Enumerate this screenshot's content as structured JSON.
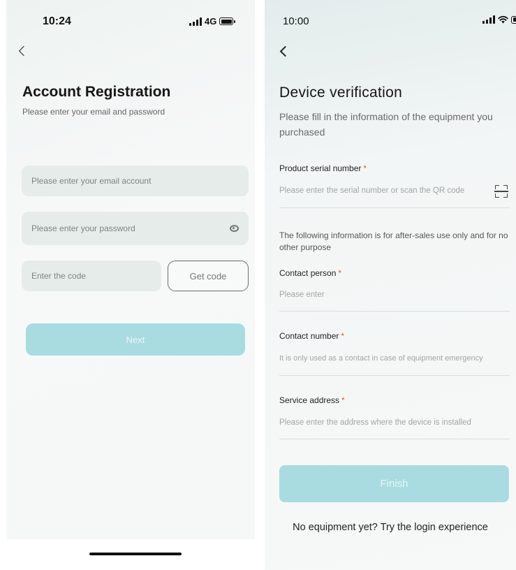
{
  "left": {
    "status": {
      "time": "10:24",
      "network": "4G"
    },
    "title": "Account Registration",
    "subtitle": "Please enter your email and password",
    "email_placeholder": "Please enter your email account",
    "password_placeholder": "Please enter your password",
    "code_placeholder": "Enter the code",
    "get_code_label": "Get code",
    "next_label": "Next"
  },
  "right": {
    "status": {
      "time": "10:00"
    },
    "title": "Device verification",
    "subtitle": "Please fill in the information of the equipment you purchased",
    "serial": {
      "label": "Product serial number",
      "placeholder": "Please enter the serial number or scan the QR code"
    },
    "note": "The following information is for after-sales use only and for no other purpose",
    "contact_person": {
      "label": "Contact person",
      "placeholder": "Please enter"
    },
    "contact_number": {
      "label": "Contact number",
      "placeholder": "It is only used as a contact in case of equipment emergency"
    },
    "service_address": {
      "label": "Service address",
      "placeholder": "Please enter the address where the device is installed"
    },
    "required_mark": "*",
    "finish_label": "Finish",
    "login_link": "No equipment yet? Try the login experience"
  },
  "colors": {
    "accent_button": "#a9dce1",
    "required_star": "#e05a3a",
    "field_bg": "#e6ecea"
  },
  "icons": [
    "back-arrow-icon",
    "signal-icon",
    "wifi-icon",
    "battery-icon",
    "eye-icon",
    "scan-qr-icon"
  ]
}
